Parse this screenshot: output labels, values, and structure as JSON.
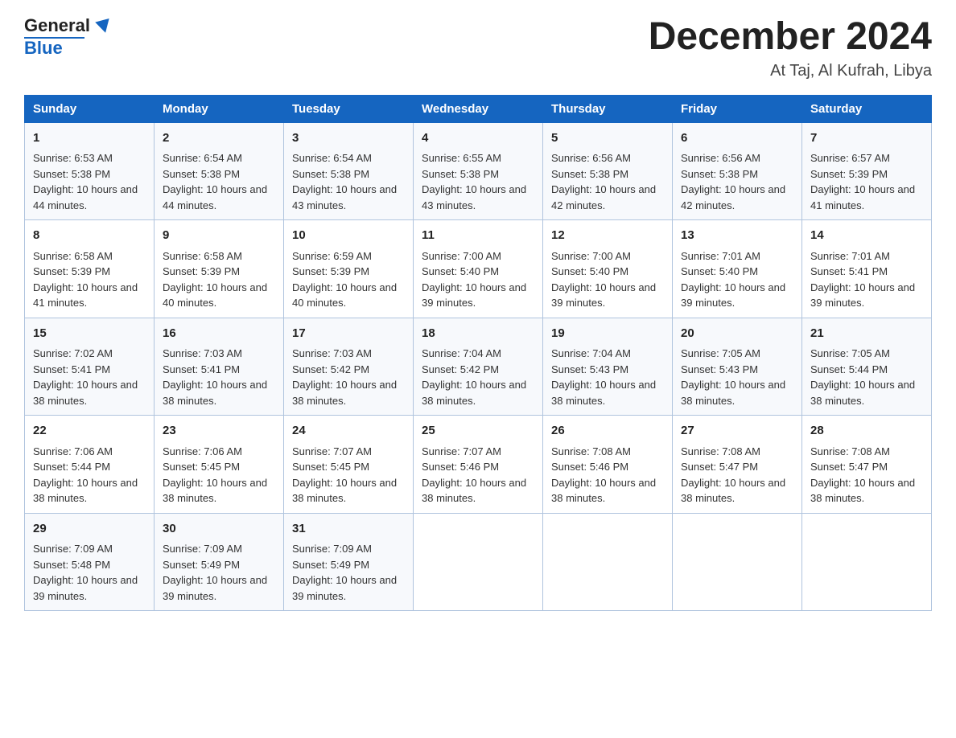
{
  "logo": {
    "general": "General",
    "blue": "Blue"
  },
  "header": {
    "month_year": "December 2024",
    "location": "At Taj, Al Kufrah, Libya"
  },
  "days_of_week": [
    "Sunday",
    "Monday",
    "Tuesday",
    "Wednesday",
    "Thursday",
    "Friday",
    "Saturday"
  ],
  "weeks": [
    [
      {
        "day": "1",
        "sunrise": "6:53 AM",
        "sunset": "5:38 PM",
        "daylight": "10 hours and 44 minutes."
      },
      {
        "day": "2",
        "sunrise": "6:54 AM",
        "sunset": "5:38 PM",
        "daylight": "10 hours and 44 minutes."
      },
      {
        "day": "3",
        "sunrise": "6:54 AM",
        "sunset": "5:38 PM",
        "daylight": "10 hours and 43 minutes."
      },
      {
        "day": "4",
        "sunrise": "6:55 AM",
        "sunset": "5:38 PM",
        "daylight": "10 hours and 43 minutes."
      },
      {
        "day": "5",
        "sunrise": "6:56 AM",
        "sunset": "5:38 PM",
        "daylight": "10 hours and 42 minutes."
      },
      {
        "day": "6",
        "sunrise": "6:56 AM",
        "sunset": "5:38 PM",
        "daylight": "10 hours and 42 minutes."
      },
      {
        "day": "7",
        "sunrise": "6:57 AM",
        "sunset": "5:39 PM",
        "daylight": "10 hours and 41 minutes."
      }
    ],
    [
      {
        "day": "8",
        "sunrise": "6:58 AM",
        "sunset": "5:39 PM",
        "daylight": "10 hours and 41 minutes."
      },
      {
        "day": "9",
        "sunrise": "6:58 AM",
        "sunset": "5:39 PM",
        "daylight": "10 hours and 40 minutes."
      },
      {
        "day": "10",
        "sunrise": "6:59 AM",
        "sunset": "5:39 PM",
        "daylight": "10 hours and 40 minutes."
      },
      {
        "day": "11",
        "sunrise": "7:00 AM",
        "sunset": "5:40 PM",
        "daylight": "10 hours and 39 minutes."
      },
      {
        "day": "12",
        "sunrise": "7:00 AM",
        "sunset": "5:40 PM",
        "daylight": "10 hours and 39 minutes."
      },
      {
        "day": "13",
        "sunrise": "7:01 AM",
        "sunset": "5:40 PM",
        "daylight": "10 hours and 39 minutes."
      },
      {
        "day": "14",
        "sunrise": "7:01 AM",
        "sunset": "5:41 PM",
        "daylight": "10 hours and 39 minutes."
      }
    ],
    [
      {
        "day": "15",
        "sunrise": "7:02 AM",
        "sunset": "5:41 PM",
        "daylight": "10 hours and 38 minutes."
      },
      {
        "day": "16",
        "sunrise": "7:03 AM",
        "sunset": "5:41 PM",
        "daylight": "10 hours and 38 minutes."
      },
      {
        "day": "17",
        "sunrise": "7:03 AM",
        "sunset": "5:42 PM",
        "daylight": "10 hours and 38 minutes."
      },
      {
        "day": "18",
        "sunrise": "7:04 AM",
        "sunset": "5:42 PM",
        "daylight": "10 hours and 38 minutes."
      },
      {
        "day": "19",
        "sunrise": "7:04 AM",
        "sunset": "5:43 PM",
        "daylight": "10 hours and 38 minutes."
      },
      {
        "day": "20",
        "sunrise": "7:05 AM",
        "sunset": "5:43 PM",
        "daylight": "10 hours and 38 minutes."
      },
      {
        "day": "21",
        "sunrise": "7:05 AM",
        "sunset": "5:44 PM",
        "daylight": "10 hours and 38 minutes."
      }
    ],
    [
      {
        "day": "22",
        "sunrise": "7:06 AM",
        "sunset": "5:44 PM",
        "daylight": "10 hours and 38 minutes."
      },
      {
        "day": "23",
        "sunrise": "7:06 AM",
        "sunset": "5:45 PM",
        "daylight": "10 hours and 38 minutes."
      },
      {
        "day": "24",
        "sunrise": "7:07 AM",
        "sunset": "5:45 PM",
        "daylight": "10 hours and 38 minutes."
      },
      {
        "day": "25",
        "sunrise": "7:07 AM",
        "sunset": "5:46 PM",
        "daylight": "10 hours and 38 minutes."
      },
      {
        "day": "26",
        "sunrise": "7:08 AM",
        "sunset": "5:46 PM",
        "daylight": "10 hours and 38 minutes."
      },
      {
        "day": "27",
        "sunrise": "7:08 AM",
        "sunset": "5:47 PM",
        "daylight": "10 hours and 38 minutes."
      },
      {
        "day": "28",
        "sunrise": "7:08 AM",
        "sunset": "5:47 PM",
        "daylight": "10 hours and 38 minutes."
      }
    ],
    [
      {
        "day": "29",
        "sunrise": "7:09 AM",
        "sunset": "5:48 PM",
        "daylight": "10 hours and 39 minutes."
      },
      {
        "day": "30",
        "sunrise": "7:09 AM",
        "sunset": "5:49 PM",
        "daylight": "10 hours and 39 minutes."
      },
      {
        "day": "31",
        "sunrise": "7:09 AM",
        "sunset": "5:49 PM",
        "daylight": "10 hours and 39 minutes."
      },
      null,
      null,
      null,
      null
    ]
  ]
}
